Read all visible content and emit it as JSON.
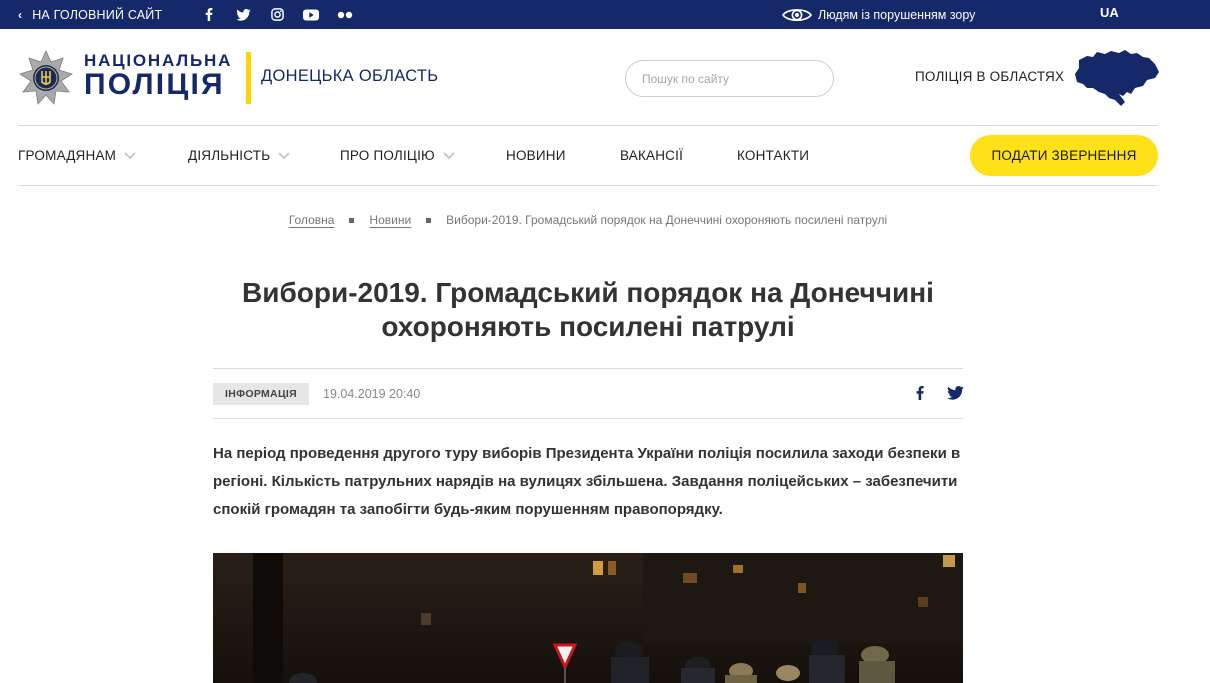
{
  "topbar": {
    "home_label": "НА ГОЛОВНИЙ САЙТ",
    "socials": [
      "facebook-icon",
      "twitter-icon",
      "instagram-icon",
      "youtube-icon",
      "flickr-icon"
    ],
    "vision_label": "Людям із порушенням зору",
    "lang": "UA"
  },
  "header": {
    "brand_line1": "НАЦІОНАЛЬНА",
    "brand_line2": "ПОЛІЦІЯ",
    "region": "ДОНЕЦЬКА ОБЛАСТЬ",
    "search_placeholder": "Пошук по сайту",
    "regions_link": "ПОЛІЦІЯ В ОБЛАСТЯХ"
  },
  "nav": {
    "items": [
      {
        "label": "ГРОМАДЯНАМ",
        "has_dropdown": true
      },
      {
        "label": "ДІЯЛЬНІСТЬ",
        "has_dropdown": true
      },
      {
        "label": "ПРО ПОЛІЦІЮ",
        "has_dropdown": true
      },
      {
        "label": "НОВИНИ",
        "has_dropdown": false
      },
      {
        "label": "ВАКАНСІЇ",
        "has_dropdown": false
      },
      {
        "label": "КОНТАКТИ",
        "has_dropdown": false
      }
    ],
    "cta": "ПОДАТИ ЗВЕРНЕННЯ"
  },
  "breadcrumb": [
    "Головна",
    "Новини",
    "Вибори-2019. Громадський порядок на Донеччині охороняють посилені патрулі"
  ],
  "article": {
    "title": "Вибори-2019. Громадський порядок на Донеччині охороняють посилені патрулі",
    "tag": "ІНФОРМАЦІЯ",
    "date": "19.04.2019 20:40",
    "lead": "На період проведення другого туру виборів Президента України поліція посилила заходи безпеки в регіоні. Кількість патрульних нарядів на вулицях збільшена. Завдання поліцейських – забезпечити спокій громадян та запобігти будь-яким порушенням правопорядку."
  },
  "colors": {
    "brand_blue": "#15286a",
    "accent_yellow": "#ffe11a"
  }
}
